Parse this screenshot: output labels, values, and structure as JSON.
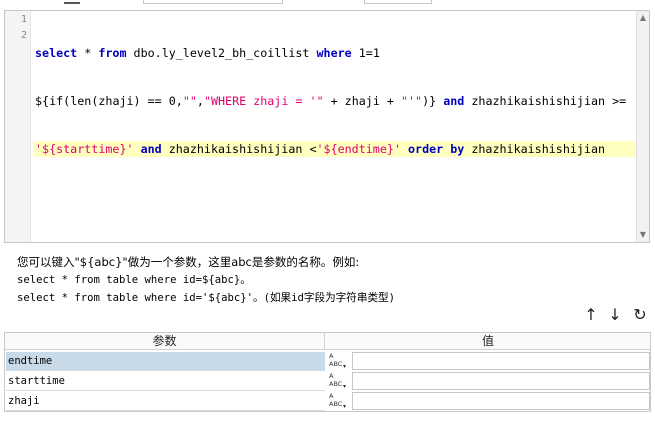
{
  "editor": {
    "line_numbers": [
      "1",
      "2"
    ]
  },
  "help": {
    "line1": "您可以键入\"${abc}\"做为一个参数，这里abc是参数的名称。例如:",
    "line2": "select * from table where id=${abc}。",
    "line3": "select * from table where id='${abc}'。(如果id字段为字符串类型)"
  },
  "toolbar": {
    "move_up_icon": "↑",
    "move_down_icon": "↓",
    "refresh_icon": "↻"
  },
  "params": {
    "headers": [
      "参数",
      "值"
    ],
    "type_badge_top": "A",
    "type_badge_bottom": "ABC",
    "rows": [
      {
        "name": "endtime",
        "value": ""
      },
      {
        "name": "starttime",
        "value": ""
      },
      {
        "name": "zhaji",
        "value": ""
      }
    ]
  },
  "code": {
    "l1": [
      "select",
      " * ",
      "from",
      " dbo.ly_level2_bh_coillist ",
      "where",
      " 1=1"
    ],
    "l2a": [
      "${",
      "if",
      "(",
      "len",
      "(zhaji) == 0,",
      "\"\"",
      ",",
      "\"WHERE zhaji = '\"",
      " + zhaji + ",
      "\"'\"",
      ")} ",
      "and",
      " zhazhikaishishijian >="
    ],
    "l2b": [
      "'${starttime}'",
      " ",
      "and",
      " zhazhikaishishijian <",
      "'${endtime}'",
      " ",
      "order",
      " ",
      "by",
      " zhazhikaishishijian"
    ]
  }
}
